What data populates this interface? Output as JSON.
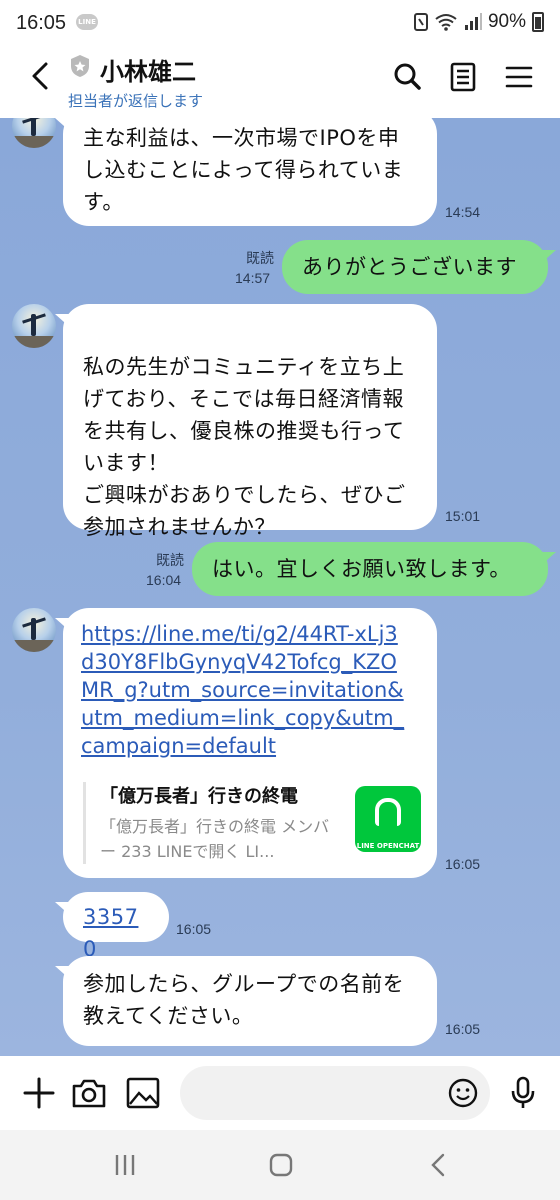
{
  "status_bar": {
    "time": "16:05",
    "app_badge": "LINE",
    "battery": "90%"
  },
  "header": {
    "contact_name": "小林雄二",
    "sub_status": "担当者が返信します",
    "icons": [
      "back-arrow-icon",
      "shield-icon",
      "search-icon",
      "notes-icon",
      "menu-icon"
    ]
  },
  "messages": [
    {
      "side": "in",
      "text": "主な利益は、一次市場でIPOを申し込むことによって得られています。",
      "time": "14:54"
    },
    {
      "side": "out",
      "text": "ありがとうございます",
      "read": "既読",
      "time": "14:57"
    },
    {
      "side": "in",
      "text": "私の先生がコミュニティを立ち上げており、そこでは毎日経済情報を共有し、優良株の推奨も行っています！\nご興味がおありでしたら、ぜひご参加されませんか？",
      "time": "15:01"
    },
    {
      "side": "out",
      "text": "はい。宜しくお願い致します。",
      "read": "既読",
      "time": "16:04"
    },
    {
      "side": "in",
      "link": "https://line.me/ti/g2/44RT-xLj3d30Y8FlbGynyqV42Tofcg_KZOMR_g?utm_source=invitation&utm_medium=link_copy&utm_campaign=default",
      "preview_title": "「億万長者」行きの終電",
      "preview_desc": "「億万長者」行きの終電 メンバー 233 LINEで開く LI...",
      "preview_badge": "LINE OPENCHAT",
      "time": "16:05"
    },
    {
      "side": "in",
      "link_text": "33570",
      "time": "16:05"
    },
    {
      "side": "in",
      "text": "参加したら、グループでの名前を教えてください。",
      "time": "16:05"
    }
  ],
  "input_bar": {
    "placeholder": "",
    "icons": [
      "plus-icon",
      "camera-icon",
      "image-icon",
      "emoji-icon",
      "microphone-icon"
    ]
  },
  "nav_bar": {
    "icons": [
      "recents-icon",
      "home-icon",
      "back-icon"
    ]
  },
  "colors": {
    "chat_background": "#8aa9d9",
    "outgoing_bubble": "#85e08a",
    "incoming_bubble": "#ffffff",
    "link": "#2b5bb8",
    "sub_status": "#3a72b8",
    "openchat_green": "#00c73c"
  }
}
